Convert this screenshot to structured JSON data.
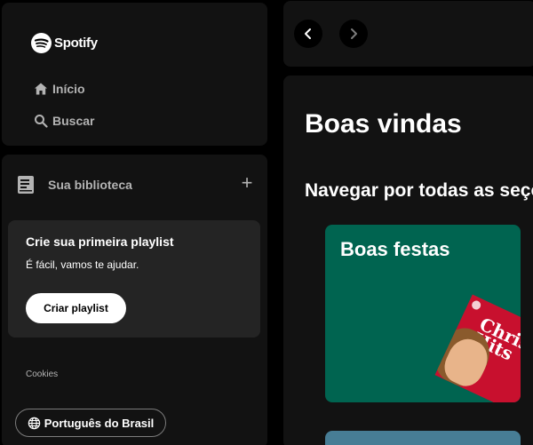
{
  "brand": {
    "name": "Spotify"
  },
  "nav": {
    "home_label": "Início",
    "search_label": "Buscar"
  },
  "library": {
    "title": "Sua biblioteca",
    "add_symbol": "+",
    "create_card": {
      "title": "Crie sua primeira playlist",
      "subtitle": "É fácil, vamos te ajudar.",
      "button_label": "Criar playlist"
    },
    "cookies_label": "Cookies",
    "language_label": "Português do Brasil"
  },
  "main": {
    "greeting": "Boas vindas",
    "browse_heading": "Navegar por todas as seções",
    "genres": [
      {
        "title": "Boas festas",
        "color": "#006450",
        "cover_text": "Christmas Hits"
      },
      {
        "title": "",
        "color": "#477d95"
      }
    ]
  },
  "colors": {
    "background": "#000000",
    "panel": "#121212",
    "card": "#242424",
    "muted_text": "#b3b3b3",
    "accent": "#1ed760"
  }
}
